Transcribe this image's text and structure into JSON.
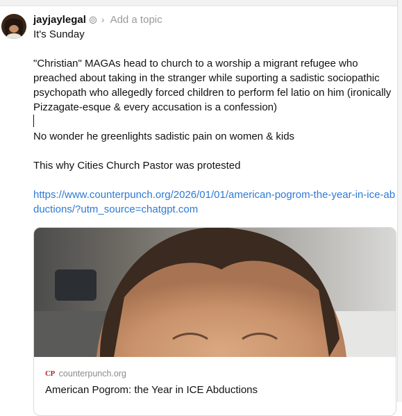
{
  "post": {
    "username": "jayjaylegal",
    "add_topic_label": "Add a topic",
    "lines": [
      "It's Sunday",
      "\"Christian\" MAGAs head to church to a worship a migrant refugee who preached about taking in the stranger while suporting a sadistic sociopathic psychopath who allegedly forced children to perform fel latio on him (ironically Pizzagate-esque & every accusation is a confession)",
      "No wonder he greenlights sadistic pain on women & kids",
      "This why Cities Church Pastor was protested"
    ],
    "link": "https://www.counterpunch.org/2026/01/01/american-pogrom-the-year-in-ice-abductions/?utm_source=chatgpt.com"
  },
  "link_card": {
    "site_logo": "CP",
    "domain": "counterpunch.org",
    "title": "American Pogrom: the Year in ICE Abductions"
  },
  "icons": {
    "verified": "verified-badge-icon",
    "chevron": "chevron-right-icon"
  },
  "colors": {
    "link": "#2d7ad6",
    "muted": "#9a9a9a",
    "logo_red": "#b3262b"
  }
}
